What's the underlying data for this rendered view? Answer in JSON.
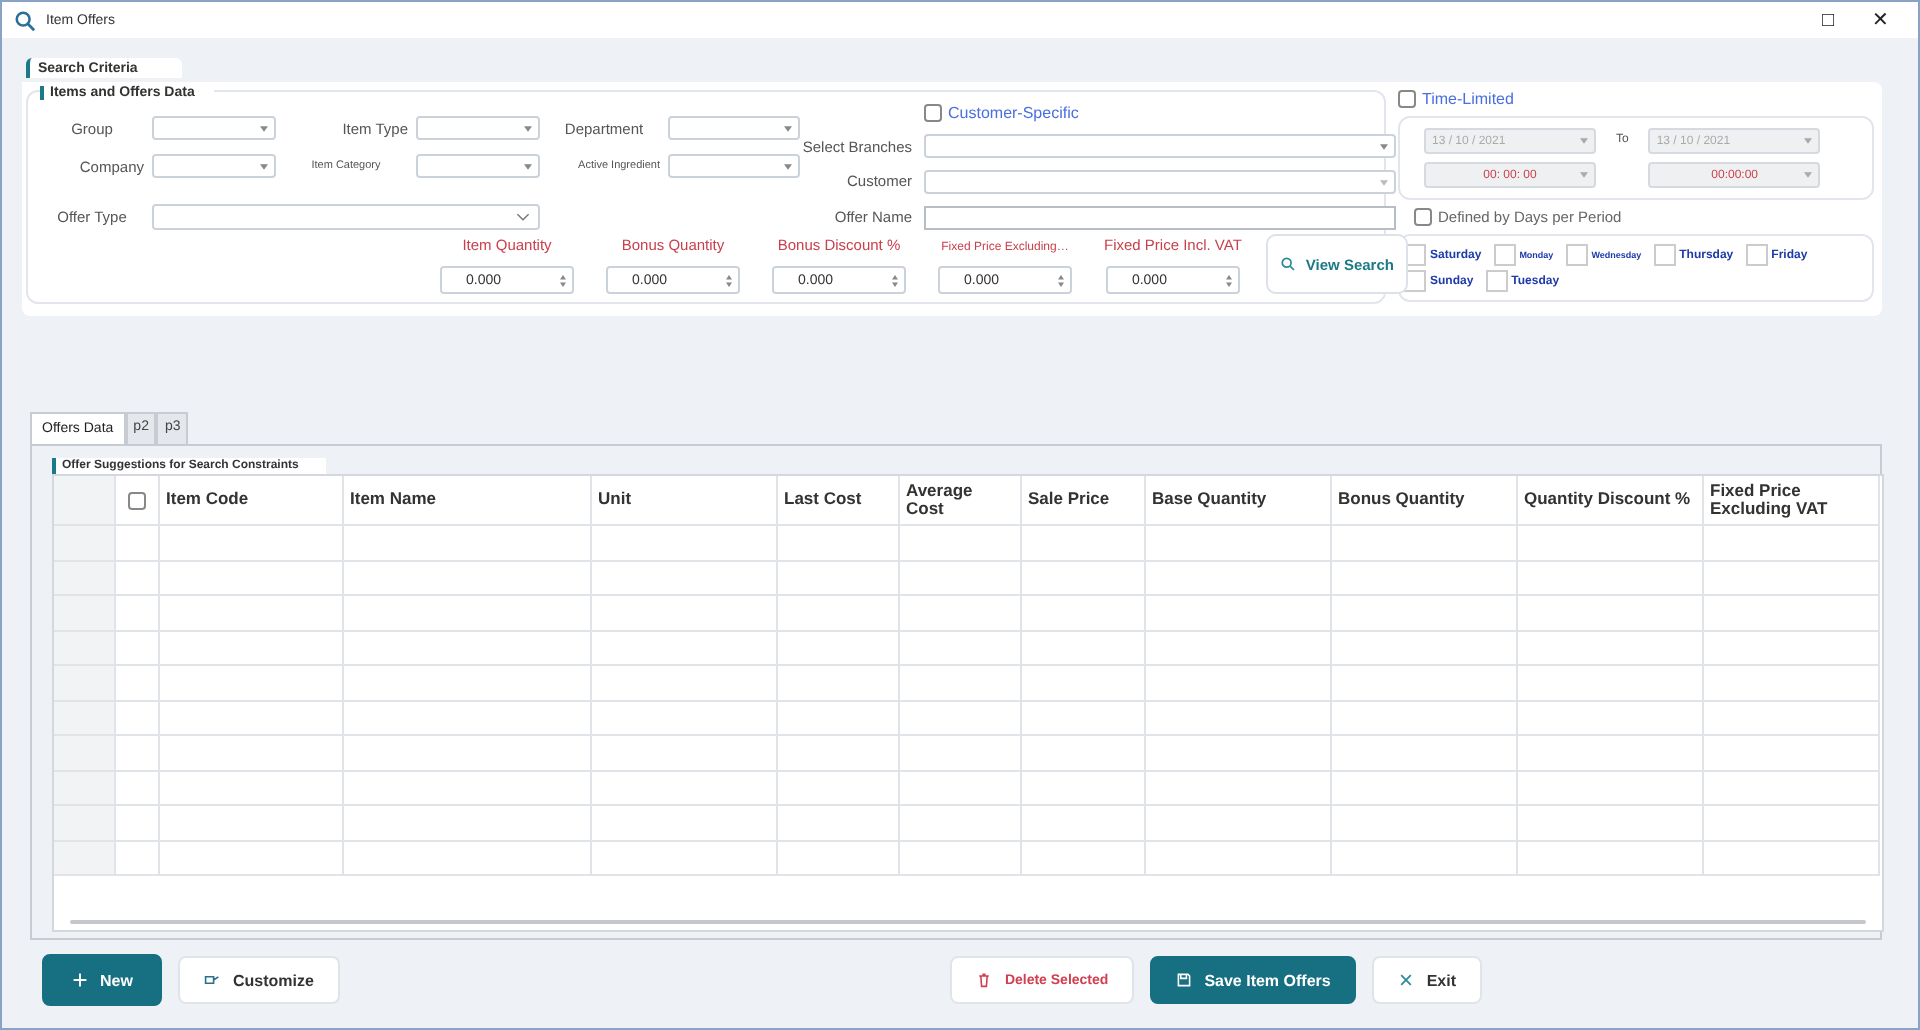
{
  "window": {
    "title": "Item Offers",
    "buttons": [
      "□",
      "✕"
    ]
  },
  "search_criteria": {
    "title": "Search Criteria",
    "items_section": {
      "title": "Items and Offers Data",
      "filters": [
        {
          "label": "Group",
          "small": false
        },
        {
          "label": "Item Type",
          "small": false
        },
        {
          "label": "Department",
          "small": false
        },
        {
          "label": "Company",
          "small": false
        },
        {
          "label": "Item Category",
          "small": true
        },
        {
          "label": "Active Ingredient",
          "small": true
        }
      ],
      "offer_type": {
        "label": "Offer Type"
      },
      "customer_specific": {
        "label": "Customer-Specific",
        "checked": false
      },
      "select_branches": {
        "label": "Select Branches"
      },
      "customer": {
        "label": "Customer"
      },
      "offer_name": {
        "label": "Offer Name"
      },
      "quantities": [
        {
          "label": "Item Quantity",
          "value": "0.000",
          "small": false
        },
        {
          "label": "Bonus Quantity",
          "value": "0.000",
          "small": false
        },
        {
          "label": "Bonus Discount %",
          "value": "0.000",
          "small": false
        },
        {
          "label": "Fixed Price  Excluding…",
          "value": "0.000",
          "small": true
        },
        {
          "label": "Fixed Price Incl. VAT",
          "value": "0.000",
          "small": false
        }
      ],
      "view_search": "View Search"
    },
    "time_limited": {
      "label": "Time-Limited",
      "checked": false,
      "from_date": "13 / 10 / 2021",
      "from_time": "00: 00: 00",
      "to_label": "To",
      "to_date": "13 / 10 / 2021",
      "to_time": "00:00:00"
    },
    "days_per_period": {
      "label": "Defined by Days per Period",
      "checked": false,
      "days": [
        {
          "label": "Saturday",
          "checked": false,
          "small": false
        },
        {
          "label": "Monday",
          "checked": false,
          "small": true
        },
        {
          "label": "Wednesday",
          "checked": false,
          "small": true
        },
        {
          "label": "Thursday",
          "checked": false,
          "small": false
        },
        {
          "label": "Friday",
          "checked": false,
          "small": false
        },
        {
          "label": "Sunday",
          "checked": false,
          "small": false
        },
        {
          "label": "Tuesday",
          "checked": false,
          "small": false
        }
      ]
    }
  },
  "tabs": [
    {
      "label": "Offers Data",
      "selected": true
    },
    {
      "label": "p2",
      "selected": false
    },
    {
      "label": "p3",
      "selected": false
    }
  ],
  "table": {
    "title": "Offer Suggestions for Search Constraints",
    "select_all_checked": false,
    "columns": [
      "Item Code",
      "Item Name",
      "Unit",
      "Last Cost",
      "Average Cost",
      "Sale Price",
      "Base Quantity",
      "Bonus Quantity",
      "Quantity Discount %",
      "Fixed Price Excluding VAT"
    ]
  },
  "buttons": [
    {
      "label": "New",
      "kind": "add"
    },
    {
      "label": "Customize",
      "kind": "customize"
    },
    {
      "label": "Delete Selected",
      "kind": "delete"
    },
    {
      "label": "Save Item Offers",
      "kind": "save"
    },
    {
      "label": "Exit",
      "kind": "exit"
    }
  ]
}
